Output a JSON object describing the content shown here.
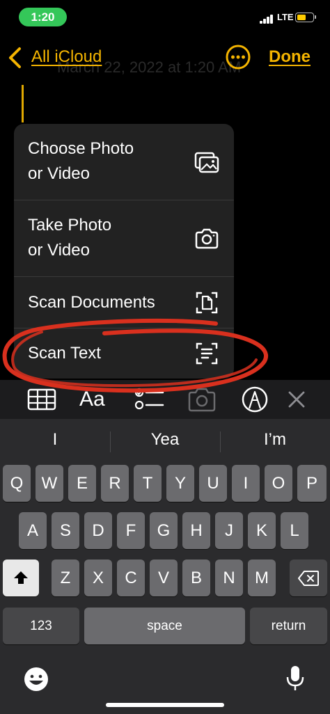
{
  "status_bar": {
    "time": "1:20",
    "network": "LTE",
    "battery_level": 0.55,
    "accent": "#34c759"
  },
  "nav": {
    "back_label": "All iCloud",
    "done_label": "Done",
    "accent": "#f4b400"
  },
  "note": {
    "date_text": "March 22, 2022 at 1:20 AM"
  },
  "menu": {
    "items": [
      {
        "label_line1": "Choose Photo",
        "label_line2": "or Video",
        "icon": "photo-library-icon"
      },
      {
        "label_line1": "Take Photo",
        "label_line2": "or Video",
        "icon": "camera-icon"
      },
      {
        "label_line1": "Scan Documents",
        "icon": "scan-document-icon"
      },
      {
        "label_line1": "Scan Text",
        "icon": "scan-text-icon"
      }
    ]
  },
  "toolbar": {
    "format_label": "Aa",
    "icons": [
      "table-icon",
      "format-icon",
      "checklist-icon",
      "camera-icon",
      "markup-icon",
      "close-icon"
    ]
  },
  "keyboard": {
    "suggestions": [
      "I",
      "Yea",
      "I’m"
    ],
    "row1": [
      "Q",
      "W",
      "E",
      "R",
      "T",
      "Y",
      "U",
      "I",
      "O",
      "P"
    ],
    "row2": [
      "A",
      "S",
      "D",
      "F",
      "G",
      "H",
      "J",
      "K",
      "L"
    ],
    "row3": [
      "Z",
      "X",
      "C",
      "V",
      "B",
      "N",
      "M"
    ],
    "numbers_label": "123",
    "space_label": "space",
    "return_label": "return"
  },
  "annotation_color": "#d9301e"
}
